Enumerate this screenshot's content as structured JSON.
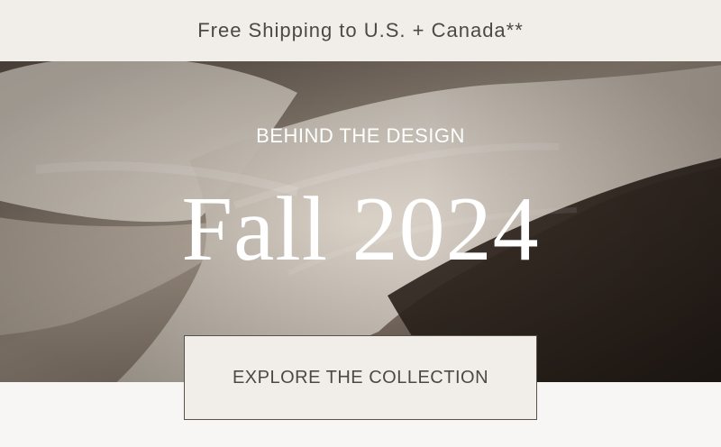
{
  "promo_bar": {
    "text": "Free Shipping to U.S. + Canada**"
  },
  "hero": {
    "eyebrow": "BEHIND THE DESIGN",
    "title": "Fall 2024",
    "image": "linen-bedding-photo"
  },
  "cta": {
    "label": "EXPLORE THE COLLECTION"
  },
  "colors": {
    "promo_bg": "#f1eee9",
    "text_dark": "#4d4843",
    "hero_text": "#ffffff",
    "button_border": "#5a514a"
  }
}
